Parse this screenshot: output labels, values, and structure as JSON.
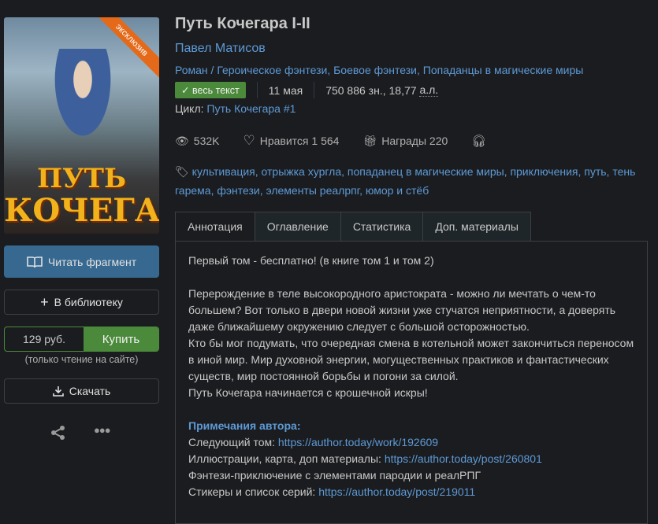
{
  "cover": {
    "ribbon": "эксклюзив",
    "title_line1": "ПУТЬ",
    "title_line2": "КОЧЕГАРА"
  },
  "sidebar": {
    "read_fragment": "Читать фрагмент",
    "add_library": "В библиотеку",
    "price": "129 руб.",
    "buy": "Купить",
    "buy_note": "(только чтение на сайте)",
    "download": "Скачать"
  },
  "book": {
    "title": "Путь Кочегара I-II",
    "author": "Павел Матисов",
    "genres": "Роман / Героическое фэнтези, Боевое фэнтези, Попаданцы в магические миры",
    "status_badge": "весь текст",
    "date": "11 мая",
    "size": "750 886 зн., 18,77",
    "size_unit": "а.л.",
    "cycle_label": "Цикл:",
    "cycle": "Путь Кочегара #1"
  },
  "stats": {
    "views": "532K",
    "likes": "Нравится 1 564",
    "awards": "Награды 220"
  },
  "tags": "культивация, отрыжка хургла, попаданец в магические миры, приключения, путь, тень гарема, фэнтези, элементы реалрпг, юмор и стёб",
  "tabs": [
    "Аннотация",
    "Оглавление",
    "Статистика",
    "Доп. материалы"
  ],
  "annotation": {
    "p1": "Первый том - бесплатно! (в книге том 1 и том 2)",
    "p2": "Перерождение в теле высокородного аристократа - можно ли мечтать о чем-то большем? Вот только в двери новой жизни уже стучатся неприятности, а доверять даже ближайшему окружению следует с большой осторожностью.",
    "p3": "Кто бы мог подумать, что очередная смена в котельной может закончиться переносом в иной мир. Мир духовной энергии, могущественных практиков и фантастических существ, мир постоянной борьбы и погони за силой.",
    "p4": "Путь Кочегара начинается с крошечной искры!",
    "notes_title": "Примечания автора:",
    "n1_label": "Следующий том: ",
    "n1_link": "https://author.today/work/192609",
    "n2_label": "Иллюстрации, карта, доп материалы: ",
    "n2_link": "https://author.today/post/260801",
    "n3": "Фэнтези-приключение с элементами пародии и реалРПГ",
    "n4_label": "Стикеры и список серий: ",
    "n4_link": "https://author.today/post/219011"
  }
}
